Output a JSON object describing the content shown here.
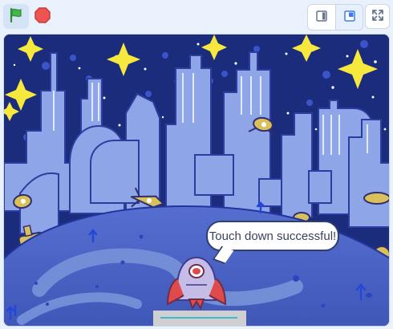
{
  "toolbar": {
    "controls": [
      {
        "name": "flag-icon",
        "color": "#36a64a"
      },
      {
        "name": "stop-icon",
        "color": "#ef5350"
      },
      {
        "name": "small-stage-icon"
      },
      {
        "name": "large-stage-icon"
      },
      {
        "name": "fullscreen-icon"
      }
    ],
    "selected_layout": "large-stage-icon"
  },
  "stage": {
    "speech_text": "Touch down successful!",
    "colors": {
      "sky": "#1a2c7b",
      "city": "#8ea5e8",
      "ground": "#4b62c6",
      "path": "#7590d8",
      "rocket": "#c5bde7",
      "accent": "#e14a4a",
      "stars": "#f7e83d"
    }
  },
  "progress": {
    "fill_color": "#45b8d8",
    "bar_color": "#cfcfcf"
  }
}
